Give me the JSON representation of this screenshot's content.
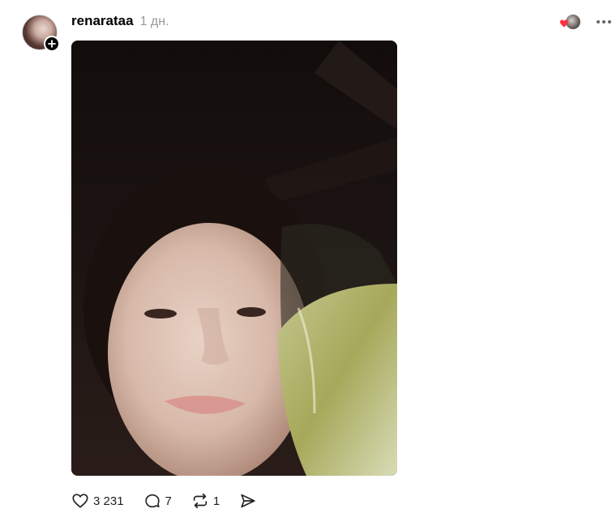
{
  "post": {
    "username": "renarataa",
    "time": "1 дн.",
    "actions": {
      "likes": "3 231",
      "replies": "7",
      "reposts": "1"
    }
  },
  "icons": {
    "follow": "plus-icon",
    "liked_by": "heart-icon",
    "more": "more-dots-icon",
    "like": "heart-outline-icon",
    "reply": "comment-bubble-icon",
    "repost": "repost-icon",
    "share": "send-icon"
  },
  "colors": {
    "heart": "#ff3040",
    "time_text": "#999999",
    "background": "#ffffff"
  }
}
